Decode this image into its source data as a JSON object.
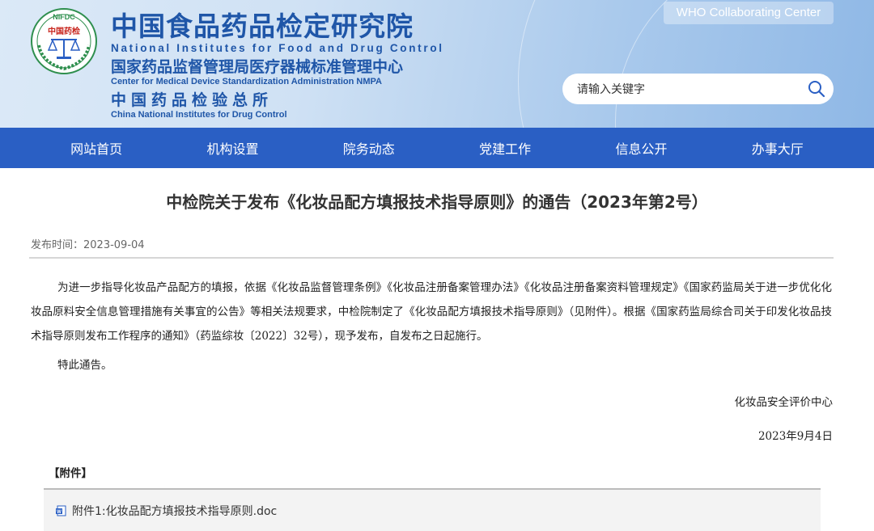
{
  "header": {
    "logo_text_top": "NIFDC",
    "logo_text_mid": "中国药检",
    "title_cn": "中国食品药品检定研究院",
    "title_en": "National Institutes for Food and Drug Control",
    "subtitle1_cn": "国家药品监督管理局医疗器械标准管理中心",
    "subtitle1_en": "Center for Medical Device Standardization Administration NMPA",
    "subtitle2_cn": "中国药品检验总所",
    "subtitle2_en": "China National Institutes for Drug Control",
    "who_label": "WHO Collaborating Center"
  },
  "search": {
    "placeholder": "请输入关键字"
  },
  "nav": {
    "items": [
      "网站首页",
      "机构设置",
      "院务动态",
      "党建工作",
      "信息公开",
      "办事大厅"
    ]
  },
  "article": {
    "title": "中检院关于发布《化妆品配方填报技术指导原则》的通告（2023年第2号）",
    "publish_label": "发布时间：",
    "publish_date": "2023-09-04",
    "paragraph1": "为进一步指导化妆品产品配方的填报，依据《化妆品监督管理条例》《化妆品注册备案管理办法》《化妆品注册备案资料管理规定》《国家药监局关于进一步优化化妆品原料安全信息管理措施有关事宜的公告》等相关法规要求，中检院制定了《化妆品配方填报技术指导原则》（见附件）。根据《国家药监局综合司关于印发化妆品技术指导原则发布工作程序的通知》（药监综妆〔2022〕32号），现予发布，自发布之日起施行。",
    "paragraph2": "特此通告。",
    "signature_org": "化妆品安全评价中心",
    "signature_date": "2023年9月4日"
  },
  "attachments": {
    "heading": "【附件】",
    "items": [
      "附件1:化妆品配方填报技术指导原则.doc"
    ]
  },
  "colors": {
    "nav_bg": "#2a5fc4",
    "brand_blue": "#1f56a8",
    "header_gradient_start": "#dbe9f7",
    "header_gradient_end": "#8fb8e6"
  }
}
